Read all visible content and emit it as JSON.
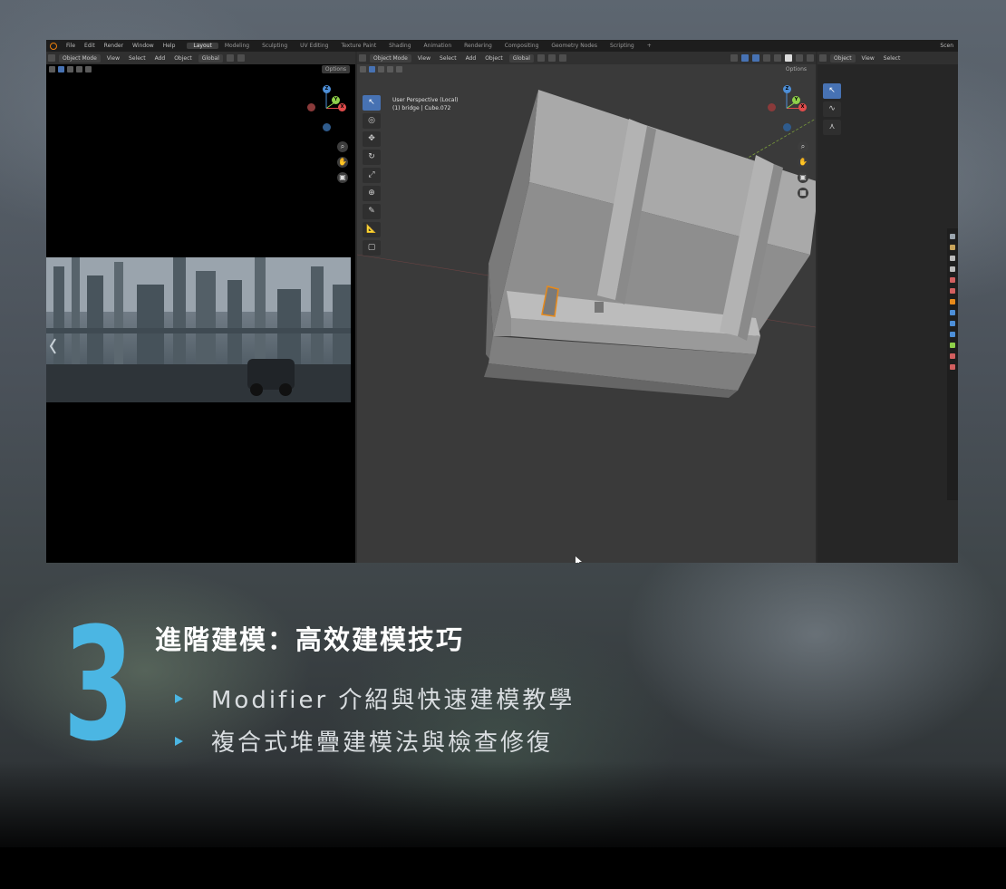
{
  "blender": {
    "menu": [
      "File",
      "Edit",
      "Render",
      "Window",
      "Help"
    ],
    "workspaces": [
      "Layout",
      "Modeling",
      "Sculpting",
      "UV Editing",
      "Texture Paint",
      "Shading",
      "Animation",
      "Rendering",
      "Compositing",
      "Geometry Nodes",
      "Scripting",
      "+"
    ],
    "active_workspace": "Layout",
    "scene_label": "Scen",
    "left_header": {
      "mode": "Object Mode",
      "view": "View",
      "select": "Select",
      "add": "Add",
      "object": "Object",
      "transform": "Global",
      "options": "Options"
    },
    "mid_header": {
      "mode": "Object Mode",
      "view": "View",
      "select": "Select",
      "add": "Add",
      "object": "Object",
      "transform": "Global",
      "options": "Options"
    },
    "viewport_info": {
      "line1": "User Perspective (Local)",
      "line2": "(1) bridge | Cube.072"
    },
    "right_header": {
      "mode": "Object",
      "view": "View",
      "select": "Select"
    },
    "gizmo_labels": {
      "x": "X",
      "y": "Y",
      "z": "Z"
    }
  },
  "caption": {
    "number": "3",
    "title": "進階建模：高效建模技巧",
    "bullets": [
      "Modifier 介紹與快速建模教學",
      "複合式堆疊建模法與檢查修復"
    ],
    "accent_color": "#4bb6e3"
  }
}
